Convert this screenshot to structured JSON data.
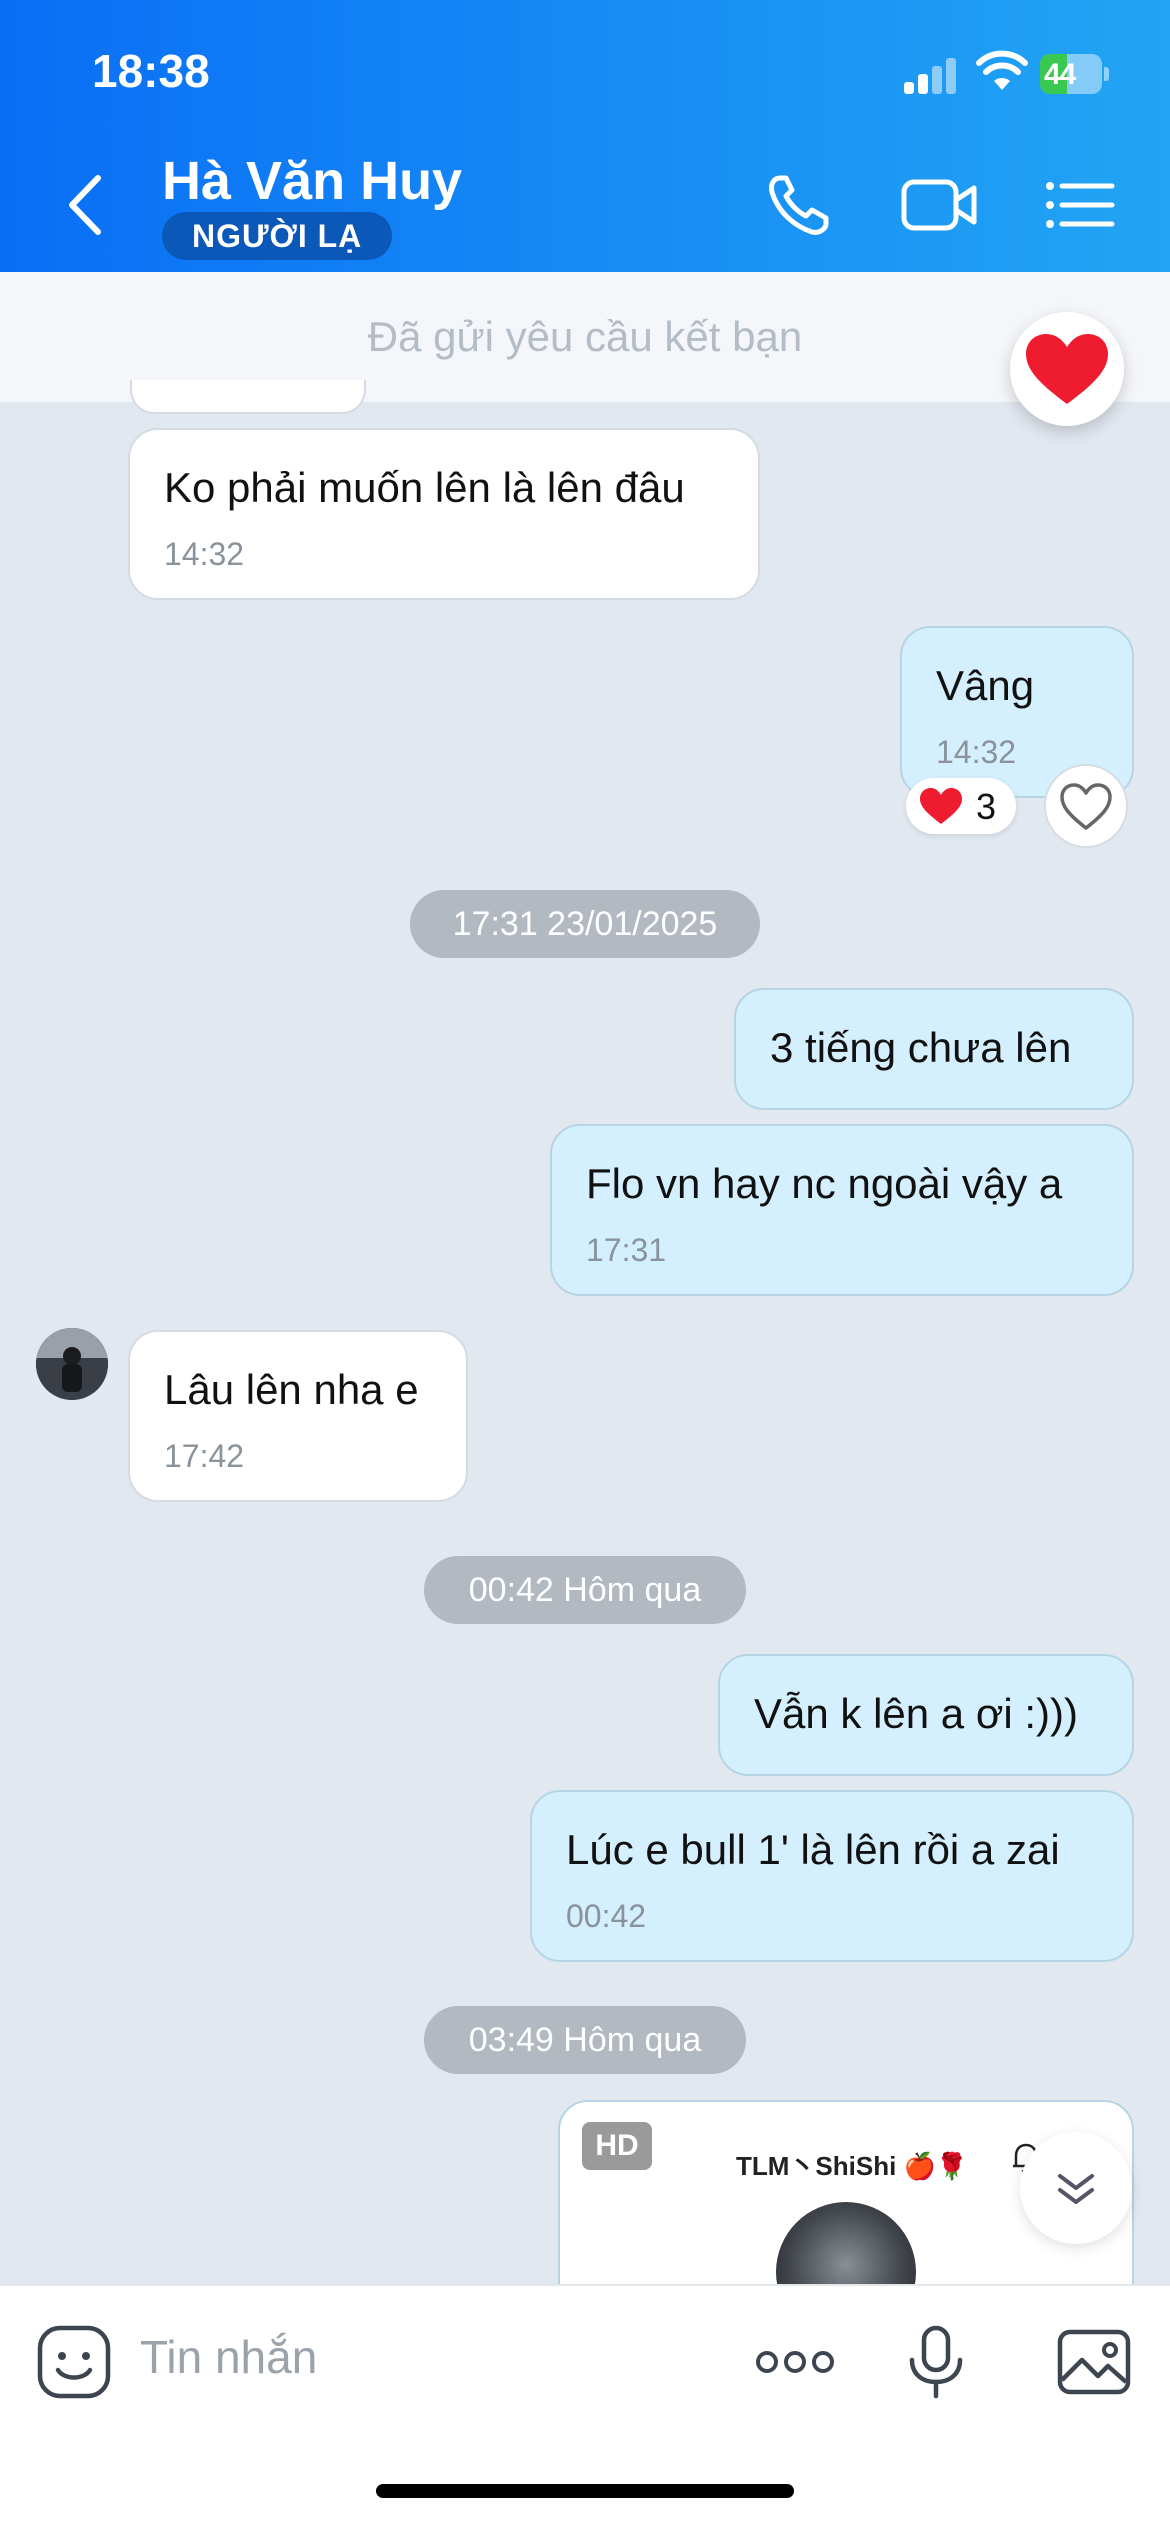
{
  "status_bar": {
    "time": "18:38",
    "battery": "44",
    "battery_percent": 44
  },
  "header": {
    "contact_name": "Hà Văn Huy",
    "badge": "NGƯỜI LẠ",
    "icons": [
      "back-icon",
      "phone-icon",
      "video-call-icon",
      "menu-list-icon"
    ]
  },
  "banner": {
    "text": "Đã gửi yêu cầu kết bạn"
  },
  "messages": [
    {
      "side": "in",
      "text": "Ko phải muốn lên là lên đâu",
      "time": "14:32"
    },
    {
      "side": "out",
      "text": "Vâng",
      "time": "14:32",
      "reaction_count": "3"
    },
    {
      "side": "out",
      "text": "3 tiếng chưa lên"
    },
    {
      "side": "out",
      "text": "Flo vn hay nc ngoài vậy a",
      "time": "17:31"
    },
    {
      "side": "in",
      "text": "Lâu lên nha e",
      "time": "17:42"
    },
    {
      "side": "out",
      "text": "Vẫn k lên a ơi :)))"
    },
    {
      "side": "out",
      "text": "Lúc e bull 1' là lên rồi a zai",
      "time": "00:42"
    }
  ],
  "date_separators": [
    "17:31 23/01/2025",
    "00:42 Hôm qua",
    "03:49 Hôm qua"
  ],
  "image_message": {
    "badge": "HD",
    "caption": "TLM丶ShiShi 🍎🌹"
  },
  "input": {
    "placeholder": "Tin nhắn",
    "icons": [
      "sticker-icon",
      "more-icon",
      "microphone-icon",
      "image-icon"
    ]
  },
  "colors": {
    "header": "#0a6ef5",
    "outgoing_bubble": "#d4effd",
    "incoming_bubble": "#ffffff",
    "heart": "#ef1b2e"
  }
}
